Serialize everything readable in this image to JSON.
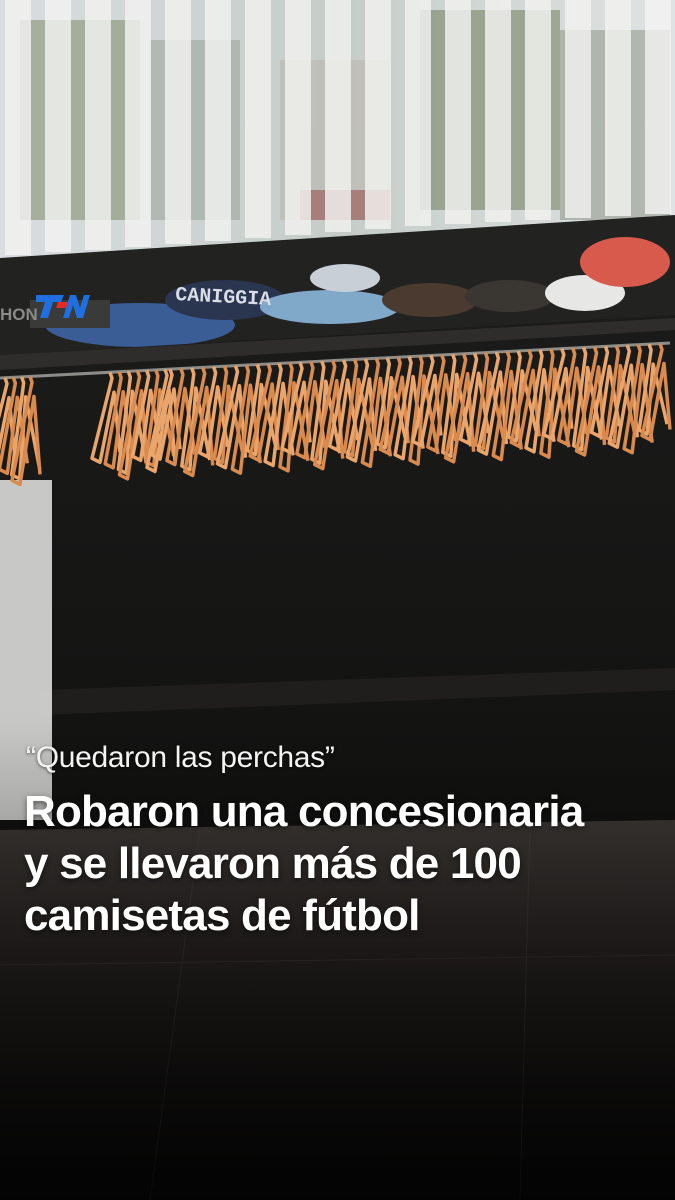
{
  "logo": {
    "text": "TN",
    "primary_color": "#1f6fe0",
    "accent_color": "#e52a2a"
  },
  "scene": {
    "shirt_print": "CANIGGIA",
    "store_sign": "HON"
  },
  "caption": {
    "kicker": "“Quedaron las perchas”",
    "headline_lines": [
      "Robaron una concesionaria",
      "y se llevaron más de 100",
      "camisetas de fútbol"
    ]
  }
}
